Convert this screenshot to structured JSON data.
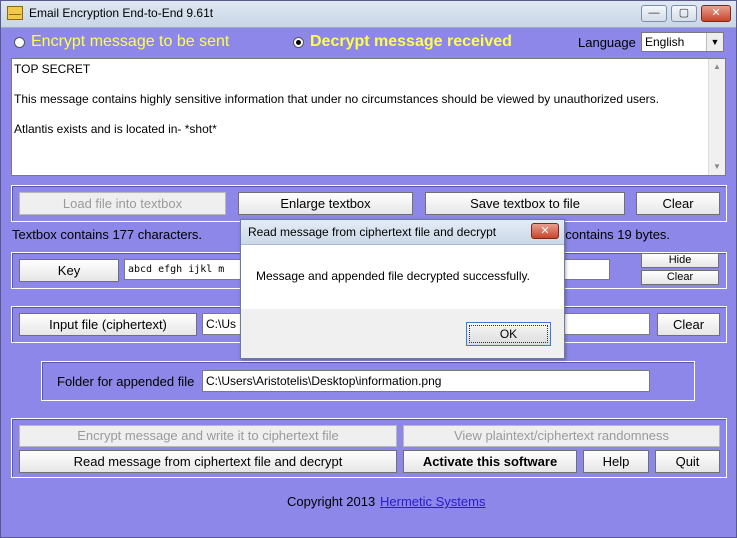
{
  "window": {
    "title": "Email Encryption End-to-End 9.61t",
    "controls": {
      "minimize": "—",
      "maximize": "▢",
      "close": "✕"
    }
  },
  "mode": {
    "encrypt_label": "Encrypt message to be sent",
    "decrypt_label": "Decrypt message received",
    "selected": "decrypt"
  },
  "language": {
    "label": "Language",
    "value": "English"
  },
  "message": {
    "lines": [
      "TOP SECRET",
      "",
      "This message contains highly sensitive information that under no circumstances should be viewed by unauthorized users.",
      "",
      "Atlantis exists and is located in- *shot*"
    ]
  },
  "textbox_buttons": {
    "load": "Load file into textbox",
    "enlarge": "Enlarge textbox",
    "save": "Save textbox to file",
    "clear": "Clear"
  },
  "status": {
    "textbox_count": "Textbox contains 177 characters.",
    "clipboard_count": "Clipboard contains 19 bytes."
  },
  "key": {
    "button": "Key",
    "value": "abcd efgh ijkl m",
    "hide": "Hide",
    "clear": "Clear"
  },
  "input_file": {
    "button": "Input file (ciphertext)",
    "value": "C:\\Us",
    "clear": "Clear"
  },
  "folder": {
    "label": "Folder for appended file",
    "value": "C:\\Users\\Aristotelis\\Desktop\\information.png"
  },
  "actions": {
    "encrypt_write": "Encrypt message and write it to ciphertext file",
    "view_randomness": "View plaintext/ciphertext randomness",
    "read_decrypt": "Read message from ciphertext file and decrypt",
    "activate": "Activate this software",
    "help": "Help",
    "quit": "Quit"
  },
  "footer": {
    "copyright": "Copyright 2013",
    "link": "Hermetic Systems"
  },
  "dialog": {
    "title": "Read message from ciphertext file and decrypt",
    "message": "Message and appended file decrypted successfully.",
    "ok": "OK",
    "close": "✕"
  },
  "colors": {
    "background": "#8c87e8",
    "mode_text": "#ffff4a",
    "link": "#2a1bd0"
  }
}
